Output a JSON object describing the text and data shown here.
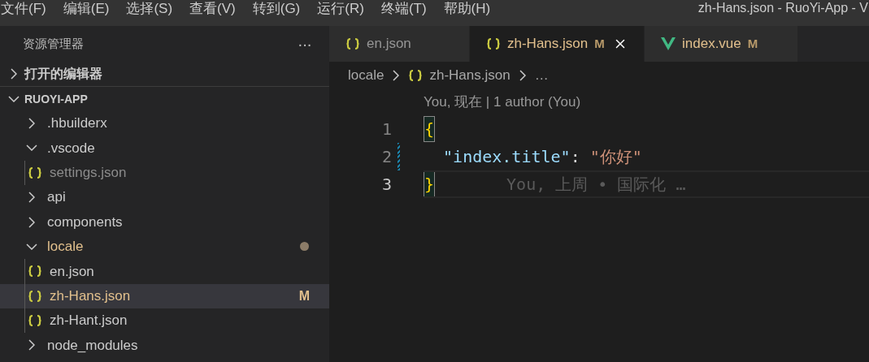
{
  "menu": [
    {
      "label": "文件(F)"
    },
    {
      "label": "编辑(E)"
    },
    {
      "label": "选择(S)"
    },
    {
      "label": "查看(V)"
    },
    {
      "label": "转到(G)"
    },
    {
      "label": "运行(R)"
    },
    {
      "label": "终端(T)"
    },
    {
      "label": "帮助(H)"
    }
  ],
  "window_title": "zh-Hans.json - RuoYi-App - V",
  "sidebar": {
    "title": "资源管理器",
    "more": "···",
    "sections": [
      {
        "label": "打开的编辑器",
        "expanded": false
      },
      {
        "label": "RUOYI-APP",
        "expanded": true
      }
    ],
    "tree": [
      {
        "kind": "folder",
        "name": ".hbuilderx",
        "expanded": false
      },
      {
        "kind": "folder",
        "name": ".vscode",
        "expanded": true,
        "children": [
          {
            "kind": "file",
            "name": "settings.json",
            "selected": false,
            "dimmed": true
          }
        ]
      },
      {
        "kind": "folder",
        "name": "api",
        "expanded": false
      },
      {
        "kind": "folder",
        "name": "components",
        "expanded": false
      },
      {
        "kind": "folder",
        "name": "locale",
        "expanded": true,
        "modified": true,
        "children": [
          {
            "kind": "file",
            "name": "en.json",
            "selected": false,
            "dimmed": false
          },
          {
            "kind": "file",
            "name": "zh-Hans.json",
            "selected": true,
            "dimmed": false,
            "badge": "M"
          },
          {
            "kind": "file",
            "name": "zh-Hant.json",
            "selected": false,
            "dimmed": false
          }
        ]
      },
      {
        "kind": "folder",
        "name": "node_modules",
        "expanded": false
      }
    ]
  },
  "tabs": [
    {
      "name": "en.json",
      "kind": "json",
      "selected": false
    },
    {
      "name": "zh-Hans.json",
      "kind": "json",
      "selected": true,
      "badge": "M"
    },
    {
      "name": "index.vue",
      "kind": "vue",
      "selected": false,
      "badge": "M"
    }
  ],
  "breadcrumb": [
    {
      "label": "locale",
      "file_icon": false
    },
    {
      "label": "zh-Hans.json",
      "file_icon": true
    },
    {
      "label": "…",
      "file_icon": false
    }
  ],
  "editor": {
    "codelens": "You, 现在 | 1 author (You)",
    "lines": [
      {
        "number": "1",
        "current": false,
        "changed": false,
        "tokens": [
          {
            "kind": "bracket",
            "text": "{"
          }
        ]
      },
      {
        "number": "2",
        "current": false,
        "changed": true,
        "tokens": [
          {
            "kind": "key",
            "text": "  \"index.title\""
          },
          {
            "kind": "punct",
            "text": ": "
          },
          {
            "kind": "string",
            "text": "\"你好\""
          }
        ]
      },
      {
        "number": "3",
        "current": true,
        "changed": false,
        "tokens": [
          {
            "kind": "bracket",
            "text": "}"
          }
        ],
        "blame": "You, 上周 • 国际化 …"
      }
    ]
  }
}
